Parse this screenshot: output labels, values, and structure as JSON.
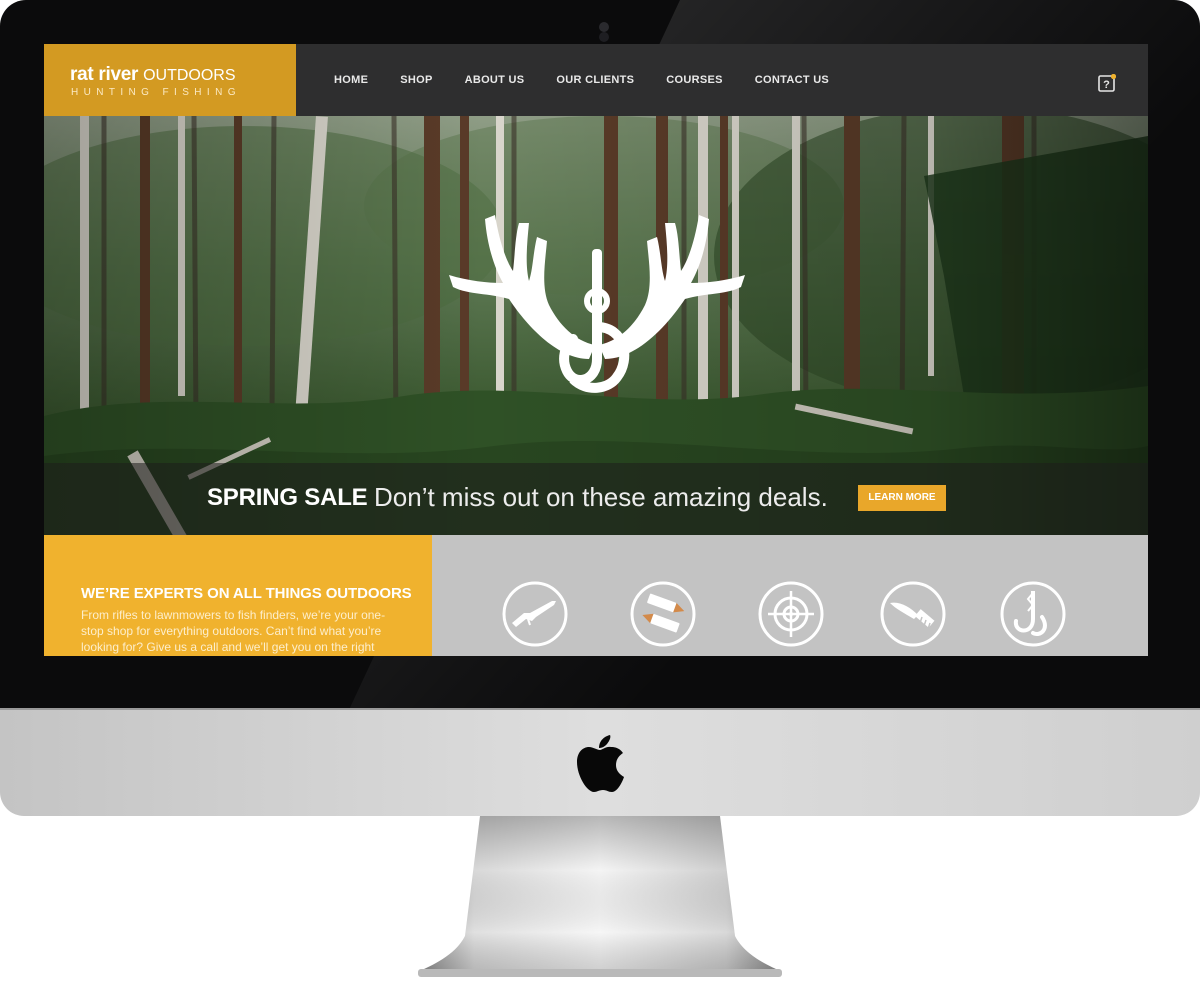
{
  "site": {
    "logo_main": "rat river",
    "logo_outdoors": "OUTDOORS",
    "logo_tagline": "HUNTING FISHING"
  },
  "nav": {
    "items": [
      {
        "label": "HOME"
      },
      {
        "label": "SHOP"
      },
      {
        "label": "ABOUT US"
      },
      {
        "label": "OUR CLIENTS"
      },
      {
        "label": "COURSES"
      },
      {
        "label": "CONTACT US"
      }
    ],
    "help_icon": "help-icon"
  },
  "hero": {
    "sale_title": "SPRING SALE",
    "sale_text": "Don’t miss out on these amazing deals.",
    "button_label": "LEARN MORE"
  },
  "promo": {
    "title": "WE’RE EXPERTS ON ALL THINGS OUTDOORS",
    "text": "From rifles to lawnmowers to fish finders, we’re your one-stop shop for everything outdoors. Can’t find what you’re looking for? Give us a call and we’ll get you on the right"
  },
  "categories": [
    {
      "icon": "rifle-icon"
    },
    {
      "icon": "ammo-icon"
    },
    {
      "icon": "target-icon"
    },
    {
      "icon": "knife-icon"
    },
    {
      "icon": "fishhook-icon"
    }
  ],
  "colors": {
    "brand_gold": "#d39a22",
    "promo_yellow": "#f0b22e",
    "button_orange": "#e9a72a",
    "nav_dark": "#2e2e2f",
    "category_gray": "#c3c3c3"
  }
}
